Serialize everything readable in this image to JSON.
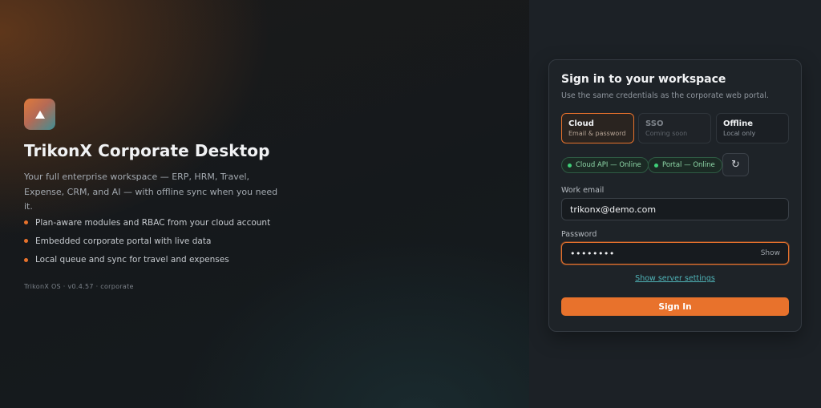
{
  "brand": {
    "title": "TrikonX Corporate Desktop",
    "description": "Your full enterprise workspace — ERP, HRM, Travel, Expense, CRM, and AI — with offline sync when you need it.",
    "features": [
      "Plan-aware modules and RBAC from your cloud account",
      "Embedded corporate portal with live data",
      "Local queue and sync for travel and expenses"
    ],
    "version": "TrikonX OS · v0.4.57 · corporate"
  },
  "signin": {
    "title": "Sign in to your workspace",
    "subtitle": "Use the same credentials as the corporate web portal.",
    "modes": [
      {
        "name": "Cloud",
        "desc": "Email & password",
        "state": "active"
      },
      {
        "name": "SSO",
        "desc": "Coming soon",
        "state": "disabled"
      },
      {
        "name": "Offline",
        "desc": "Local only",
        "state": "normal"
      }
    ],
    "status": [
      {
        "label": "Cloud API — Online"
      },
      {
        "label": "Portal — Online"
      }
    ],
    "refresh_icon": "↻",
    "email_label": "Work email",
    "email_value": "trikonx@demo.com",
    "password_label": "Password",
    "password_mask": "••••••••",
    "show_label": "Show",
    "server_settings_link": "Show server settings",
    "submit_label": "Sign In"
  },
  "colors": {
    "accent": "#e8722c",
    "online": "#3fcf78",
    "link": "#4fb3b7"
  }
}
